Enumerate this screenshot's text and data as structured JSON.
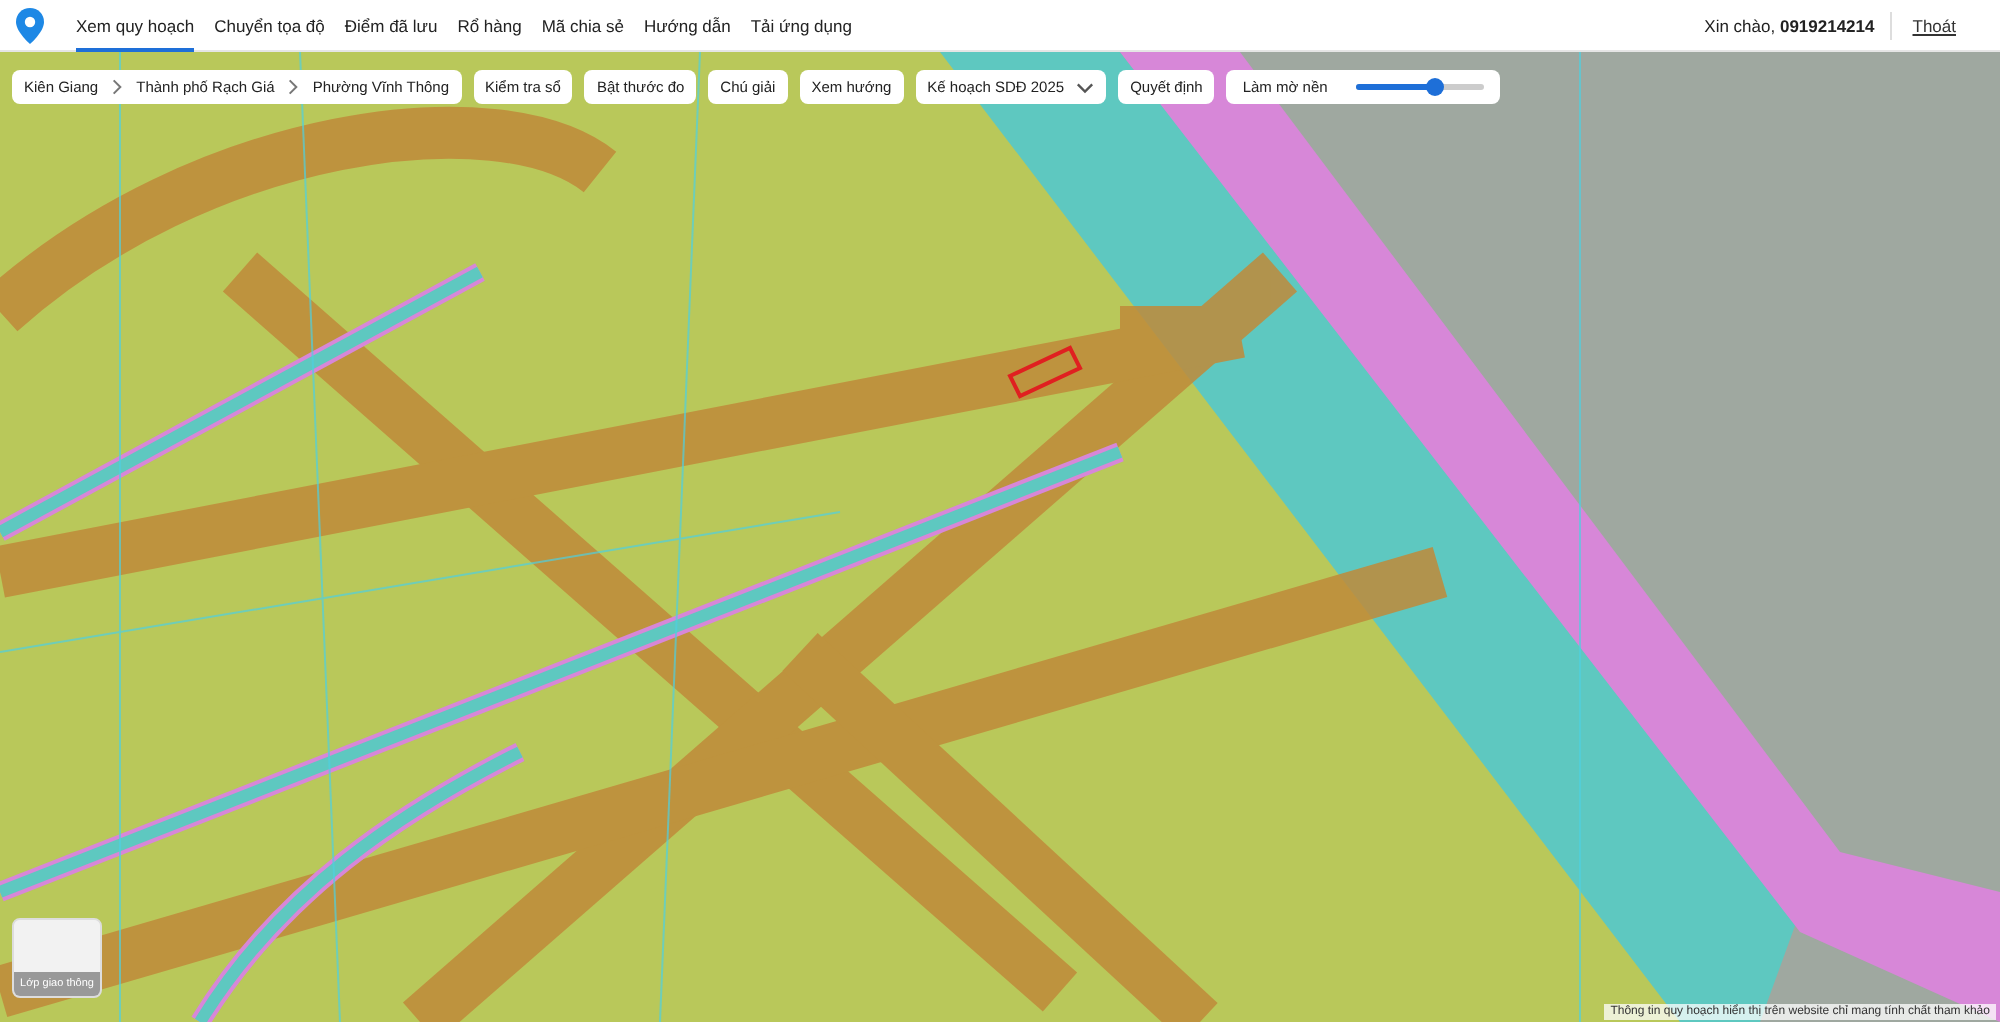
{
  "nav": {
    "items": [
      {
        "label": "Xem quy hoạch",
        "selected": true
      },
      {
        "label": "Chuyển tọa độ",
        "selected": false
      },
      {
        "label": "Điểm đã lưu",
        "selected": false
      },
      {
        "label": "Rổ hàng",
        "selected": false
      },
      {
        "label": "Mã chia sẻ",
        "selected": false
      },
      {
        "label": "Hướng dẫn",
        "selected": false
      },
      {
        "label": "Tải ứng dụng",
        "selected": false
      }
    ],
    "greeting": "Xin chào, ",
    "user": "0919214214",
    "logout": "Thoát"
  },
  "toolbar": {
    "breadcrumb": [
      "Kiên Giang",
      "Thành phố Rạch Giá",
      "Phường Vĩnh Thông"
    ],
    "buttons": [
      {
        "kind": "button",
        "label": "Kiểm tra sổ"
      },
      {
        "kind": "button",
        "label": "Bật thước đo"
      },
      {
        "kind": "button",
        "label": "Chú giải"
      },
      {
        "kind": "button",
        "label": "Xem hướng"
      },
      {
        "kind": "dropdown",
        "label": "Kế hoạch SDĐ 2025"
      },
      {
        "kind": "button",
        "label": "Quyết định"
      }
    ],
    "blur": {
      "label": "Làm mờ nền",
      "level": 0.62
    }
  },
  "layer_toggle": {
    "label": "Lớp giao thông"
  },
  "disclaimer": "Thông tin quy hoạch hiển thị trên website chỉ mang tính chất tham khảo"
}
